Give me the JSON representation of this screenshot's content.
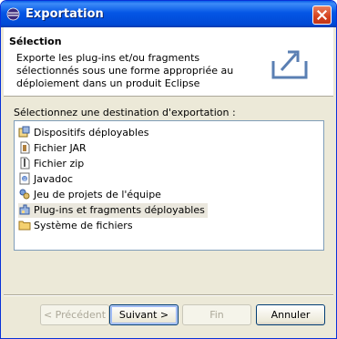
{
  "window": {
    "title": "Exportation"
  },
  "header": {
    "title": "Sélection",
    "description": "Exporte les plug-ins et/ou fragments sélectionnés sous une forme appropriée au déploiement dans un produit Eclipse"
  },
  "destination": {
    "label": "Sélectionnez une destination d'exportation :",
    "items": [
      {
        "label": "Dispositifs déployables",
        "icon": "feature-icon"
      },
      {
        "label": "Fichier JAR",
        "icon": "jar-file-icon"
      },
      {
        "label": "Fichier zip",
        "icon": "zip-file-icon"
      },
      {
        "label": "Javadoc",
        "icon": "javadoc-icon"
      },
      {
        "label": "Jeu de projets de l'équipe",
        "icon": "team-project-icon"
      },
      {
        "label": "Plug-ins et fragments déployables",
        "icon": "plugin-icon",
        "selected": true
      },
      {
        "label": "Système de fichiers",
        "icon": "folder-icon"
      }
    ]
  },
  "buttons": {
    "back": "< Précédent",
    "next": "Suivant >",
    "finish": "Fin",
    "cancel": "Annuler"
  }
}
